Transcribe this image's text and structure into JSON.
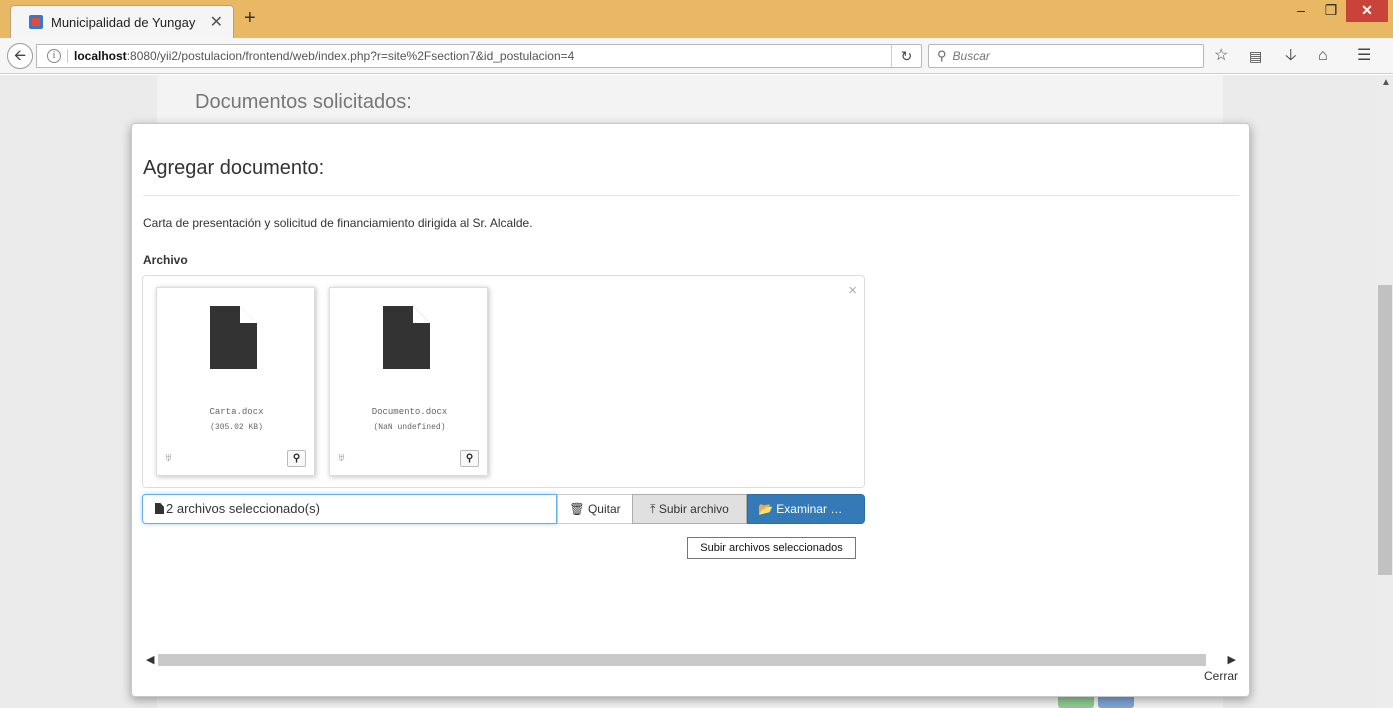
{
  "browser": {
    "tab_title": "Municipalidad de Yungay",
    "tab_close": "✕",
    "new_tab": "+",
    "window_controls": {
      "minimize": "–",
      "maximize": "❐",
      "close": "✕"
    },
    "url_host": "localhost",
    "url_rest": ":8080/yii2/postulacion/frontend/web/index.php?r=site%2Fsection7&id_postulacion=4",
    "search_placeholder": "Buscar",
    "icons": [
      "back-arrow-icon",
      "info-icon",
      "reload-icon",
      "search-icon",
      "bookmark-star-icon",
      "reading-list-icon",
      "download-icon",
      "home-icon",
      "menu-icon"
    ]
  },
  "page": {
    "background_heading": "Documentos solicitados:"
  },
  "modal": {
    "title": "Agregar documento:",
    "description": "Carta de presentación y solicitud de financiamiento dirigida al Sr. Alcalde.",
    "file_label": "Archivo",
    "preview_close": "×",
    "files": [
      {
        "name": "Carta.docx",
        "size": "(305.02 KB)"
      },
      {
        "name": "Documento.docx",
        "size": "(NaN undefined)"
      }
    ],
    "caption": "2 archivos seleccionado(s)",
    "buttons": {
      "remove": "Quitar",
      "upload": "Subir archivo",
      "browse": "Examinar …"
    },
    "tooltip": "Subir archivos seleccionados",
    "close": "Cerrar"
  },
  "colors": {
    "titlebar": "#e8b865",
    "primary": "#337ab7",
    "close_button": "#c9433a"
  }
}
